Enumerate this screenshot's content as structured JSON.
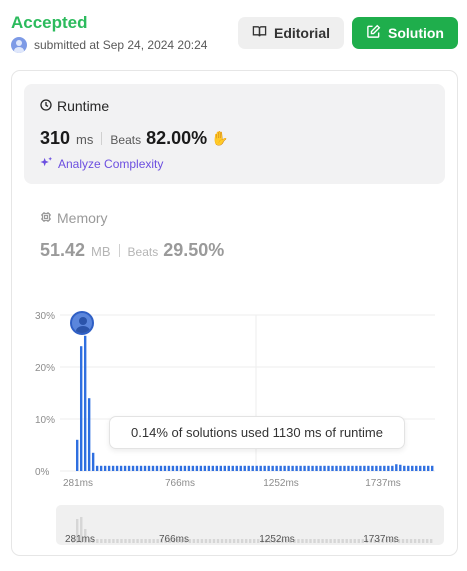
{
  "status": {
    "title": "Accepted",
    "submitted": "submitted at Sep 24, 2024 20:24"
  },
  "buttons": {
    "editorial": "Editorial",
    "solution": "Solution"
  },
  "runtime": {
    "title": "Runtime",
    "value": "310",
    "unit": "ms",
    "beats_label": "Beats",
    "beats_value": "82.00%",
    "analyze": "Analyze Complexity"
  },
  "memory": {
    "title": "Memory",
    "value": "51.42",
    "unit": "MB",
    "beats_label": "Beats",
    "beats_value": "29.50%"
  },
  "tooltip": "0.14% of solutions used 1130 ms of runtime",
  "colors": {
    "accent": "#2cbb5d",
    "bar": "#2f6fe0",
    "solution_button": "#1fae4c",
    "analyze": "#6c4fe0"
  },
  "chart_data": {
    "type": "bar",
    "yticks": [
      "30%",
      "20%",
      "10%",
      "0%"
    ],
    "ylim": [
      0,
      30
    ],
    "xticks": [
      "281ms",
      "766ms",
      "1252ms",
      "1737ms"
    ],
    "values": [
      6,
      24,
      26,
      14,
      3.5,
      1,
      1,
      1,
      1,
      1,
      1,
      1,
      1,
      1,
      1,
      1,
      1,
      1,
      1,
      1,
      1,
      1,
      1,
      1,
      1,
      1,
      1,
      1,
      1,
      1,
      1,
      1,
      1,
      1,
      1,
      1,
      1,
      1,
      1,
      1,
      1,
      1,
      1,
      1,
      1,
      1,
      1,
      1,
      1,
      1,
      1,
      1,
      1,
      1,
      1,
      1,
      1,
      1,
      1,
      1,
      1,
      1,
      1,
      1,
      1,
      1,
      1,
      1,
      1,
      1,
      1,
      1,
      1,
      1,
      1,
      1,
      1,
      1,
      1,
      1,
      1.3,
      1.2,
      1,
      1,
      1,
      1,
      1,
      1,
      1,
      1
    ]
  },
  "mini_chart": {
    "xticks": [
      "281ms",
      "766ms",
      "1252ms",
      "1737ms"
    ]
  }
}
